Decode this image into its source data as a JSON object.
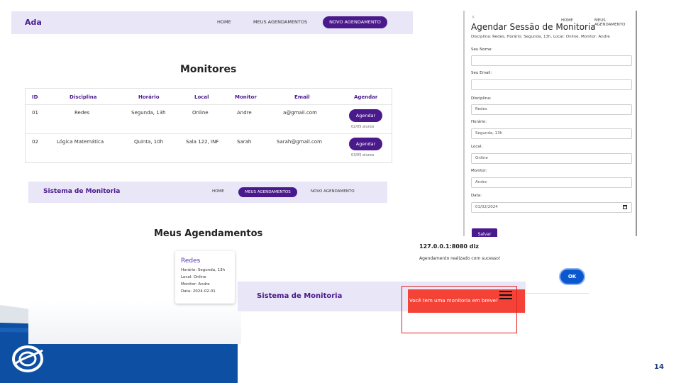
{
  "slide": {
    "page_number": "14"
  },
  "monitores_screen": {
    "nav": {
      "brand": "Ada",
      "links": [
        "HOME",
        "MEUS AGENDAMENTOS"
      ],
      "active": "NOVO AGENDAMENTO"
    },
    "title": "Monitores",
    "table": {
      "headers": [
        "ID",
        "Disciplina",
        "Horário",
        "Local",
        "Monitor",
        "Email",
        "Agendar"
      ],
      "rows": [
        {
          "id": "01",
          "disciplina": "Redes",
          "horario": "Segunda, 13h",
          "local": "Online",
          "monitor": "Andre",
          "email": "a@gmail.com",
          "button": "Agendar",
          "vagas": "02/05 alunos"
        },
        {
          "id": "02",
          "disciplina": "Lógica Matemática",
          "horario": "Quinta, 10h",
          "local": "Sala 122, INF",
          "monitor": "Sarah",
          "email": "Sarah@gmail.com",
          "button": "Agendar",
          "vagas": "03/05 alunos"
        }
      ]
    }
  },
  "agendamentos_screen": {
    "nav": {
      "brand": "Sistema de Monitoria",
      "home": "HOME",
      "active": "MEUS AGENDAMENTOS",
      "novo": "NOVO AGENDAMENTO"
    },
    "title": "Meus Agendamentos",
    "card": {
      "title": "Redes",
      "horario": "Horário: Segunda, 13h",
      "local": "Local: Online",
      "monitor": "Monitor: Andre",
      "data": "Data: 2024-02-01"
    }
  },
  "form_screen": {
    "close": "×",
    "ghost_home": "HOME",
    "ghost_meus": "MEUS AGENDAMENTO",
    "title": "Agendar Sessão de Monitoria",
    "subtitle": "Disciplina: Redes, Horário: Segunda, 13h, Local: Online, Monitor: Andre",
    "fields": {
      "nome_label": "Seu Nome:",
      "nome_value": "",
      "email_label": "Seu Email:",
      "email_value": "",
      "disciplina_label": "Disciplina:",
      "disciplina_value": "Redes",
      "horario_label": "Horário:",
      "horario_value": "Segunda, 13h",
      "local_label": "Local:",
      "local_value": "Online",
      "monitor_label": "Monitor:",
      "monitor_value": "Andre",
      "data_label": "Data:",
      "data_value": "01/02/2024"
    },
    "save": "Salvar"
  },
  "alert_dialog": {
    "host": "127.0.0.1:8080 diz",
    "message": "Agendamento realizado com sucesso!",
    "ok": "OK"
  },
  "toast_screen": {
    "brand": "Sistema de Monitoria",
    "toast": "Você tem uma monitoria em breve!"
  },
  "colors": {
    "primary": "#4a1a8c",
    "nav_bg": "#e9e6f7",
    "toast": "#f44336",
    "footer_blue": "#0d4fa3"
  }
}
